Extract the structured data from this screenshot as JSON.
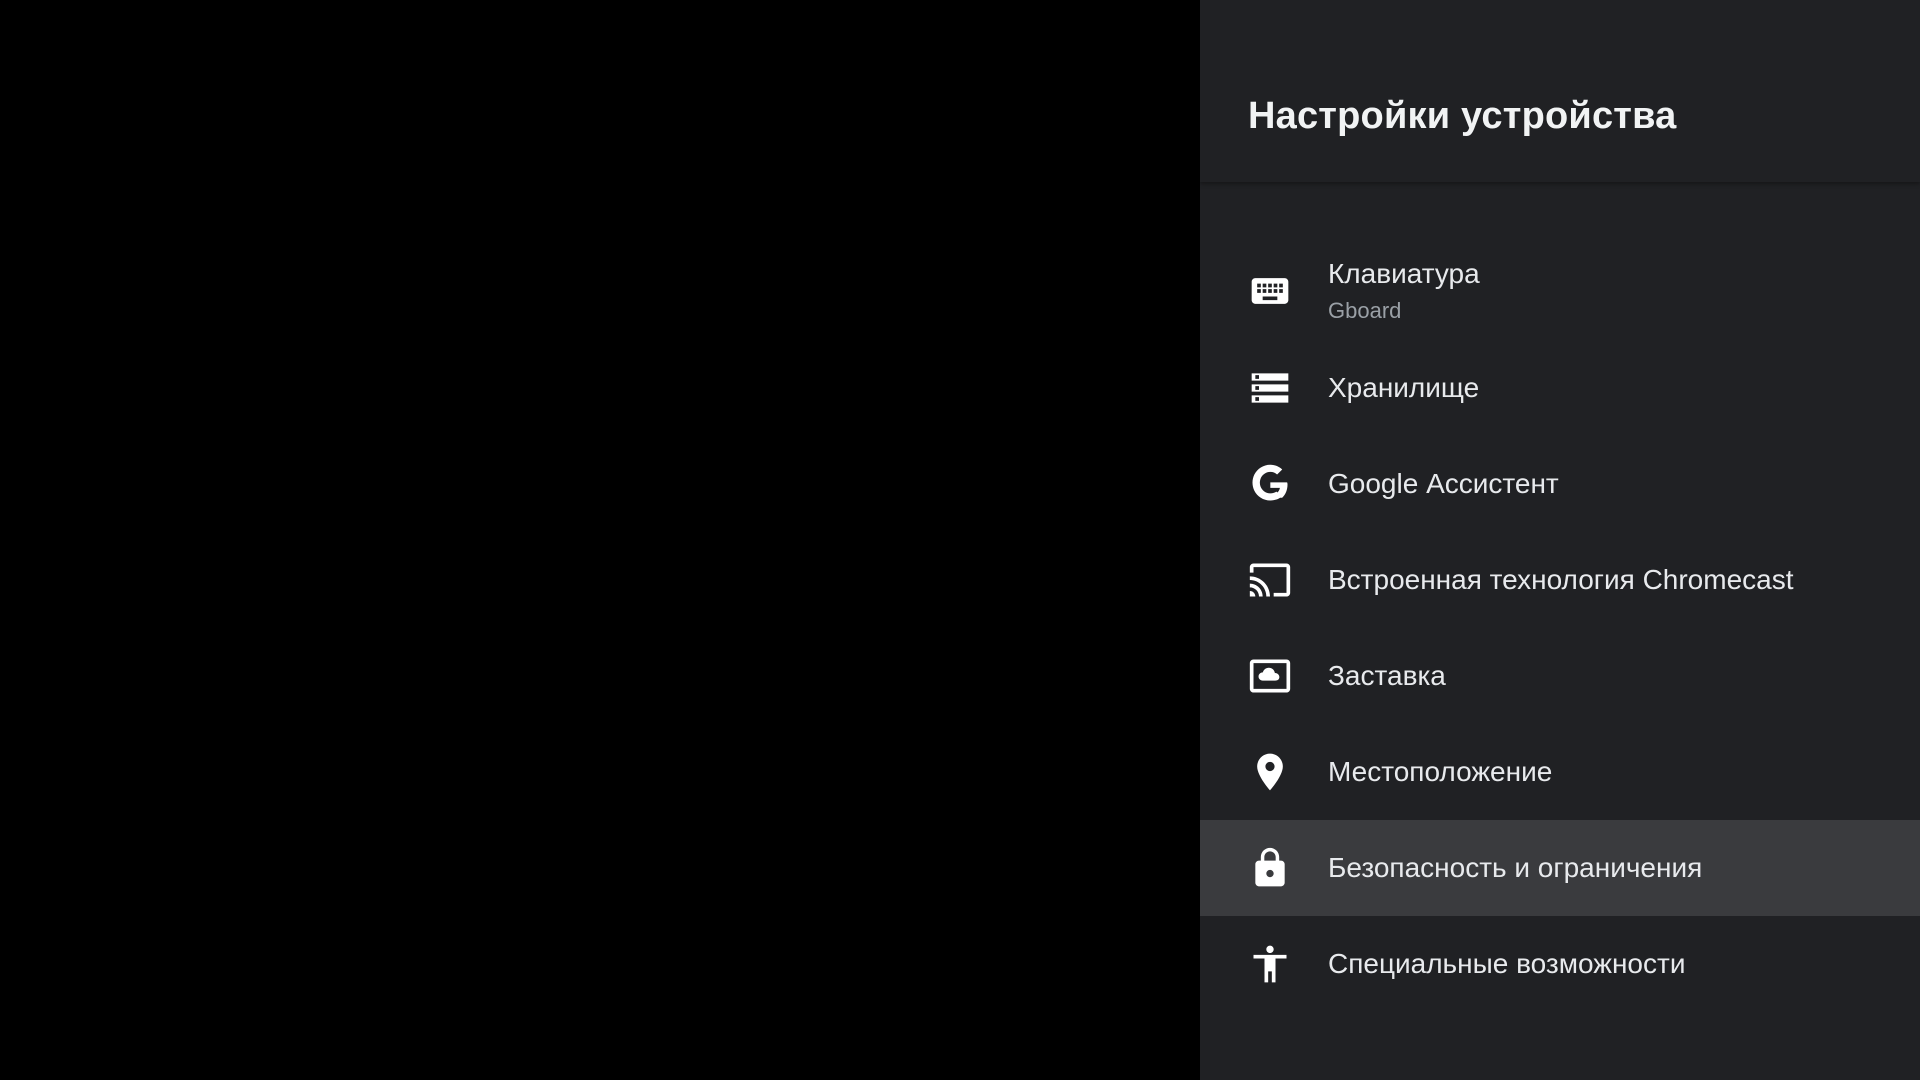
{
  "header": {
    "title": "Настройки устройства"
  },
  "menu": {
    "items": [
      {
        "label": "Клавиатура",
        "sublabel": "Gboard",
        "icon": "keyboard-icon"
      },
      {
        "label": "Хранилище",
        "icon": "storage-icon"
      },
      {
        "label": "Google Ассистент",
        "icon": "google-g-icon"
      },
      {
        "label": "Встроенная технология Chromecast",
        "icon": "cast-icon"
      },
      {
        "label": "Заставка",
        "icon": "screensaver-icon"
      },
      {
        "label": "Местоположение",
        "icon": "location-pin-icon"
      },
      {
        "label": "Безопасность и ограничения",
        "icon": "lock-icon",
        "selected": true
      },
      {
        "label": "Специальные возможности",
        "icon": "accessibility-icon"
      }
    ]
  },
  "colors": {
    "background": "#000000",
    "panel": "#202124",
    "selected_row": "#3a3b3e",
    "primary_text": "#e8eaed",
    "secondary_text": "#9aa0a6",
    "icon": "#ffffff"
  }
}
